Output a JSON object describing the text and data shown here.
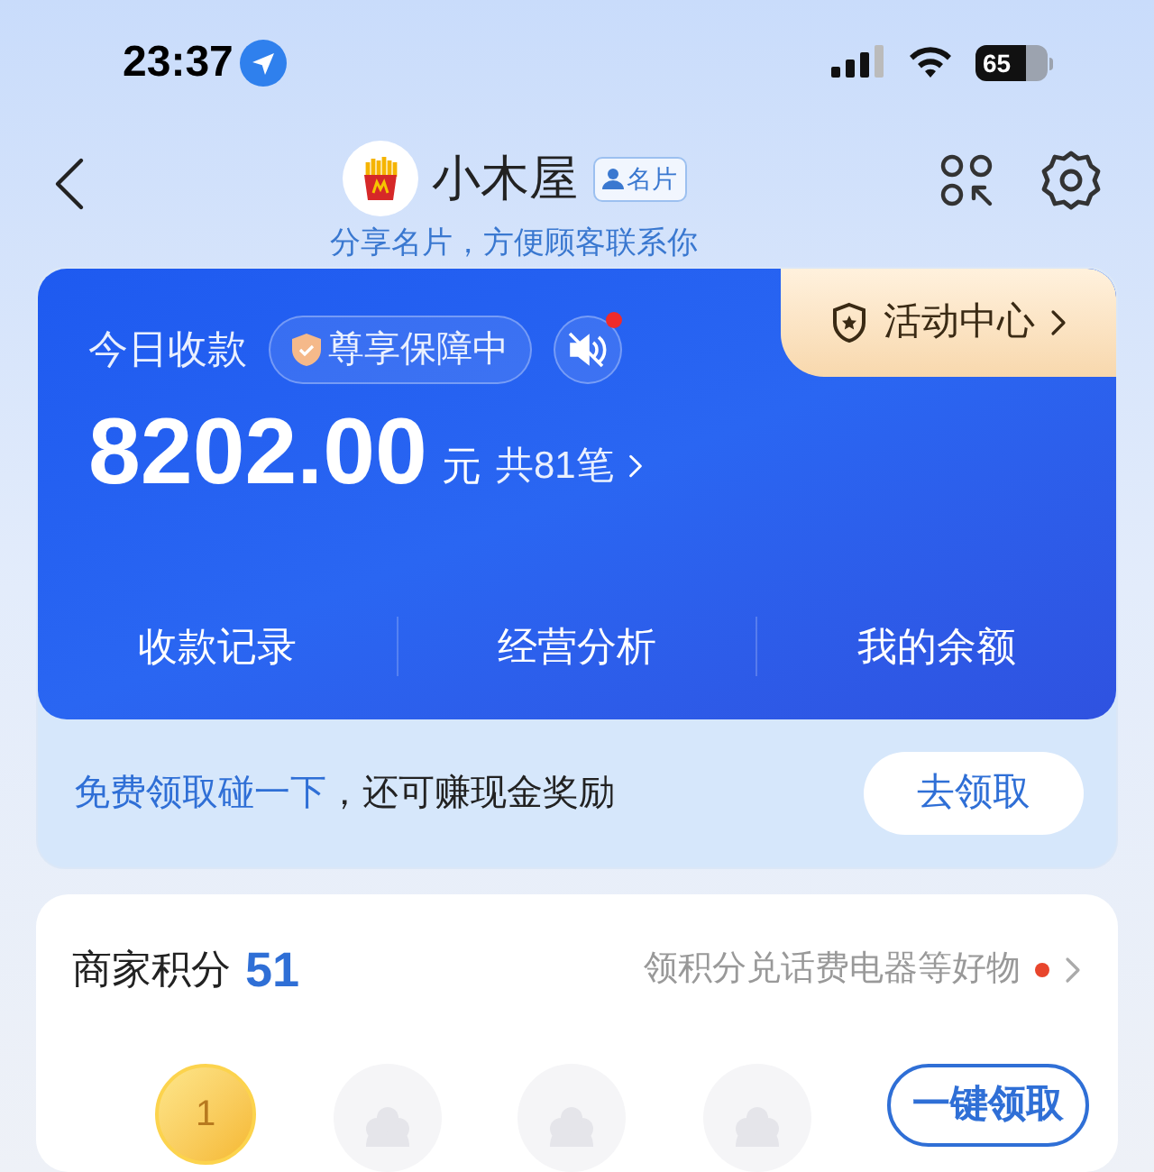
{
  "status_bar": {
    "time": "23:37",
    "battery": "65"
  },
  "header": {
    "title": "小木屋",
    "badge": "名片",
    "subtitle": "分享名片，方便顾客联系你"
  },
  "income_card": {
    "label": "今日收款",
    "protection": "尊享保障中",
    "sound_muted": true,
    "sound_badge": true,
    "activity": "活动中心",
    "amount": "8202.00",
    "unit": "元",
    "count": "共81笔",
    "links": [
      "收款记录",
      "经营分析",
      "我的余额"
    ]
  },
  "promo": {
    "highlight": "免费领取碰一下",
    "text": "，还可赚现金奖励",
    "button": "去领取"
  },
  "points": {
    "title": "商家积分",
    "value": "51",
    "promo": "领积分兑话费电器等好物",
    "promo_dot": true,
    "coins": [
      {
        "kind": "coin",
        "label": "1"
      },
      {
        "kind": "locked"
      },
      {
        "kind": "locked"
      },
      {
        "kind": "locked"
      }
    ],
    "button": "一键领取"
  }
}
